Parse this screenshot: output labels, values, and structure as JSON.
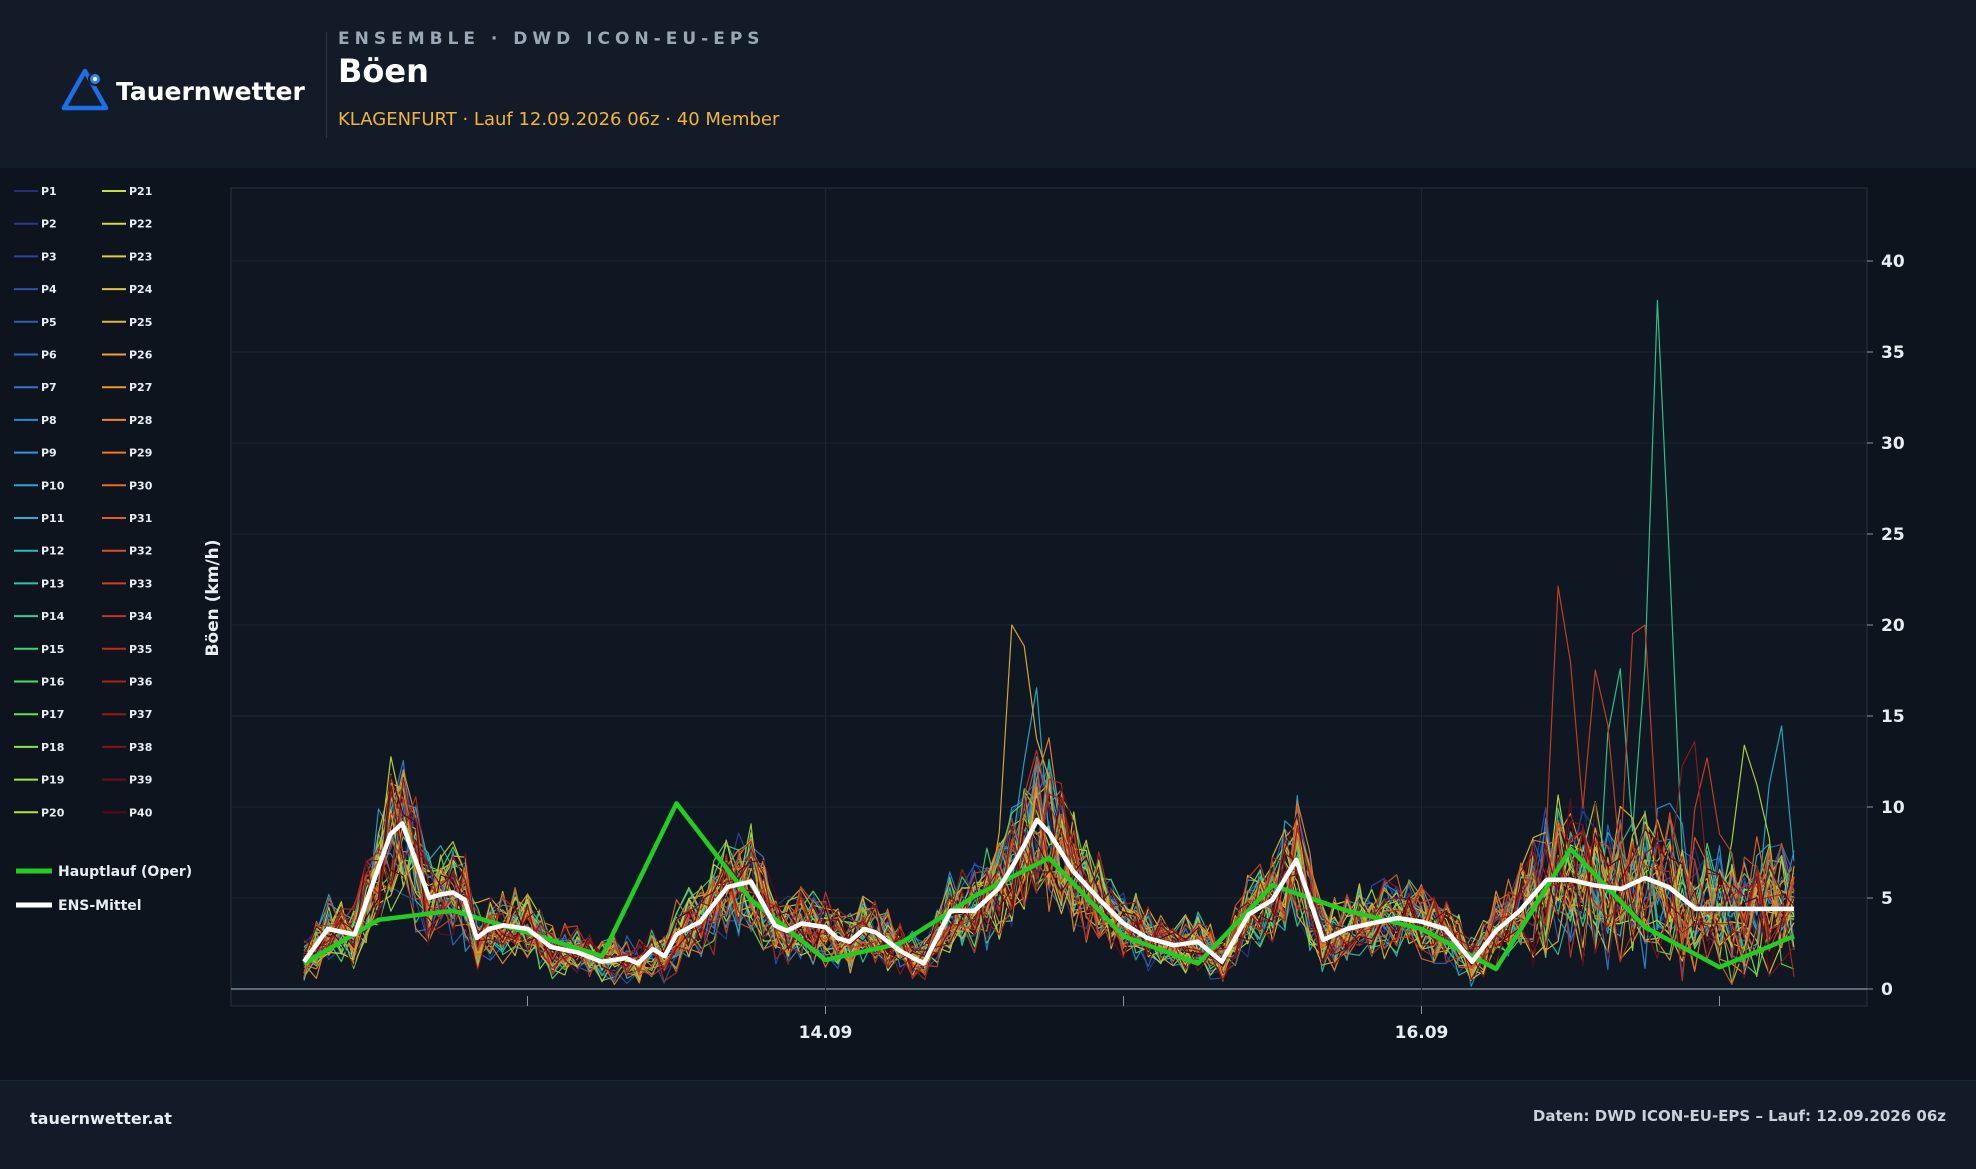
{
  "header": {
    "brand": "Tauernwetter",
    "kicker": "ENSEMBLE · DWD ICON-EU-EPS",
    "title": "Böen",
    "subtitle": "KLAGENFURT · Lauf 12.09.2026 06z · 40 Member"
  },
  "footer": {
    "site": "tauernwetter.at",
    "source": "Daten: DWD ICON-EU-EPS – Lauf: 12.09.2026 06z"
  },
  "colors": {
    "oper": "#22cc22",
    "mean": "#ffffff",
    "background": "#0e141d",
    "plot_background": "#0f1722"
  },
  "chart_data": {
    "type": "line",
    "ylabel": "Böen (km/h)",
    "ylim": [
      -1,
      44
    ],
    "y_ticks": [
      0,
      5,
      10,
      15,
      20,
      25,
      30,
      35,
      40
    ],
    "x_axis": {
      "range_days": [
        "12.09 06z",
        "17.09 12z"
      ],
      "major_ticks": [
        {
          "label": "14.09",
          "day_offset": 1.75
        },
        {
          "label": "16.09",
          "day_offset": 3.75
        }
      ],
      "minor_ticks_day_offset": [
        0.75,
        2.75,
        4.75
      ],
      "grid": true
    },
    "legend": {
      "placement": "left",
      "oper_label": "Hauptlauf (Oper)",
      "mean_label": "ENS-Mittel"
    },
    "member_labels": [
      "P1",
      "P2",
      "P3",
      "P4",
      "P5",
      "P6",
      "P7",
      "P8",
      "P9",
      "P10",
      "P11",
      "P12",
      "P13",
      "P14",
      "P15",
      "P16",
      "P17",
      "P18",
      "P19",
      "P20",
      "P21",
      "P22",
      "P23",
      "P24",
      "P25",
      "P26",
      "P27",
      "P28",
      "P29",
      "P30",
      "P31",
      "P32",
      "P33",
      "P34",
      "P35",
      "P36",
      "P37",
      "P38",
      "P39",
      "P40"
    ],
    "member_colors": [
      "#26307a",
      "#283b8a",
      "#2a469a",
      "#2b51aa",
      "#2c5eb8",
      "#2d6ac6",
      "#2e78d2",
      "#2f86d8",
      "#2f94d8",
      "#2fa2d2",
      "#2db0c6",
      "#2cbcb8",
      "#2dc6a6",
      "#32cf92",
      "#3ad67e",
      "#4ade6a",
      "#5fe25a",
      "#7ee64e",
      "#9ae646",
      "#b4e43e",
      "#c8e03a",
      "#d6da38",
      "#e0cf36",
      "#e6c234",
      "#ebb432",
      "#eea430",
      "#f0962e",
      "#f0872c",
      "#ee782a",
      "#ea6a28",
      "#e45c26",
      "#dc4e24",
      "#d24222",
      "#c63620",
      "#b82c1e",
      "#a8221c",
      "#96181a",
      "#841218",
      "#700c16",
      "#5c0812"
    ],
    "mean": {
      "day_offset": [
        0.0,
        0.08,
        0.17,
        0.29,
        0.33,
        0.42,
        0.46,
        0.5,
        0.54,
        0.58,
        0.62,
        0.67,
        0.75,
        0.83,
        0.92,
        1.0,
        1.08,
        1.12,
        1.17,
        1.21,
        1.25,
        1.33,
        1.42,
        1.5,
        1.54,
        1.58,
        1.62,
        1.67,
        1.75,
        1.79,
        1.83,
        1.88,
        1.92,
        2.0,
        2.08,
        2.17,
        2.25,
        2.33,
        2.38,
        2.42,
        2.46,
        2.5,
        2.58,
        2.67,
        2.75,
        2.83,
        2.92,
        3.0,
        3.08,
        3.17,
        3.25,
        3.33,
        3.42,
        3.5,
        3.58,
        3.67,
        3.75,
        3.83,
        3.92,
        4.0,
        4.08,
        4.17,
        4.25,
        4.33,
        4.42,
        4.5,
        4.58,
        4.67,
        4.75,
        4.83,
        4.92,
        5.0
      ],
      "values": [
        1.5,
        3.3,
        3.0,
        8.5,
        9.1,
        5.0,
        5.2,
        5.3,
        4.9,
        2.8,
        3.3,
        3.5,
        3.3,
        2.3,
        2.0,
        1.5,
        1.7,
        1.4,
        2.2,
        1.8,
        3.0,
        3.7,
        5.6,
        5.9,
        4.7,
        3.5,
        3.2,
        3.6,
        3.4,
        2.8,
        2.6,
        3.3,
        3.1,
        2.1,
        1.4,
        4.3,
        4.3,
        5.5,
        6.8,
        8.0,
        9.3,
        8.6,
        6.5,
        4.9,
        3.6,
        2.8,
        2.4,
        2.6,
        1.5,
        4.1,
        4.9,
        7.1,
        2.7,
        3.3,
        3.6,
        3.9,
        3.7,
        3.3,
        1.5,
        3.2,
        4.3,
        6.0,
        6.0,
        5.7,
        5.5,
        6.1,
        5.6,
        4.4,
        4.4,
        4.4,
        4.4,
        4.4
      ]
    },
    "oper": {
      "day_offset": [
        0.0,
        0.25,
        0.5,
        0.75,
        1.0,
        1.25,
        1.5,
        1.75,
        2.0,
        2.25,
        2.5,
        2.75,
        3.0,
        3.25,
        3.5,
        3.75,
        4.0,
        4.25,
        4.5,
        4.75,
        5.0
      ],
      "values": [
        1.4,
        3.8,
        4.3,
        3.1,
        1.8,
        10.2,
        4.9,
        1.6,
        2.5,
        5.1,
        7.2,
        2.9,
        1.4,
        5.7,
        4.3,
        3.3,
        1.1,
        7.7,
        3.4,
        1.2,
        2.9
      ]
    }
  }
}
